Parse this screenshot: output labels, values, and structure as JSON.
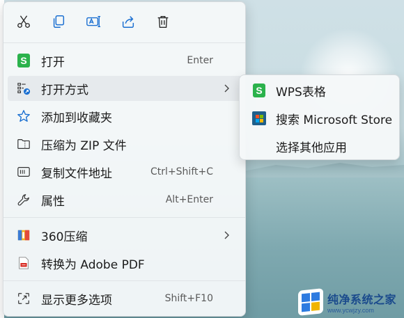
{
  "toolbar": {
    "buttons": [
      {
        "name": "cut",
        "icon": "scissors-icon"
      },
      {
        "name": "copy",
        "icon": "copy-icon"
      },
      {
        "name": "rename",
        "icon": "rename-icon"
      },
      {
        "name": "share",
        "icon": "share-icon"
      },
      {
        "name": "delete",
        "icon": "trash-icon"
      }
    ]
  },
  "menu": {
    "items": [
      {
        "label": "打开",
        "shortcut": "Enter",
        "icon": "wps-sheet-icon"
      },
      {
        "label": "打开方式",
        "shortcut": "",
        "icon": "open-with-icon",
        "submenu": true
      },
      {
        "label": "添加到收藏夹",
        "shortcut": "",
        "icon": "star-icon"
      },
      {
        "label": "压缩为 ZIP 文件",
        "shortcut": "",
        "icon": "zip-folder-icon"
      },
      {
        "label": "复制文件地址",
        "shortcut": "Ctrl+Shift+C",
        "icon": "copy-path-icon"
      },
      {
        "label": "属性",
        "shortcut": "Alt+Enter",
        "icon": "wrench-icon"
      },
      {
        "label": "360压缩",
        "shortcut": "",
        "icon": "archive-360-icon",
        "submenu": true
      },
      {
        "label": "转换为 Adobe PDF",
        "shortcut": "",
        "icon": "pdf-icon"
      },
      {
        "label": "显示更多选项",
        "shortcut": "Shift+F10",
        "icon": "more-options-icon"
      }
    ]
  },
  "submenu": {
    "items": [
      {
        "label": "WPS表格",
        "icon": "wps-sheet-icon"
      },
      {
        "label": "搜索 Microsoft Store",
        "icon": "store-icon"
      },
      {
        "label": "选择其他应用",
        "icon": ""
      }
    ]
  },
  "icons": {
    "wps_letter": "S"
  },
  "watermark": {
    "title": "纯净系统之家",
    "url": "www.ycwjzy.com"
  },
  "colors": {
    "wps_green": "#2bb24c",
    "accent_blue": "#1a6fd1",
    "watermark_blue": "#1a4a8c"
  }
}
